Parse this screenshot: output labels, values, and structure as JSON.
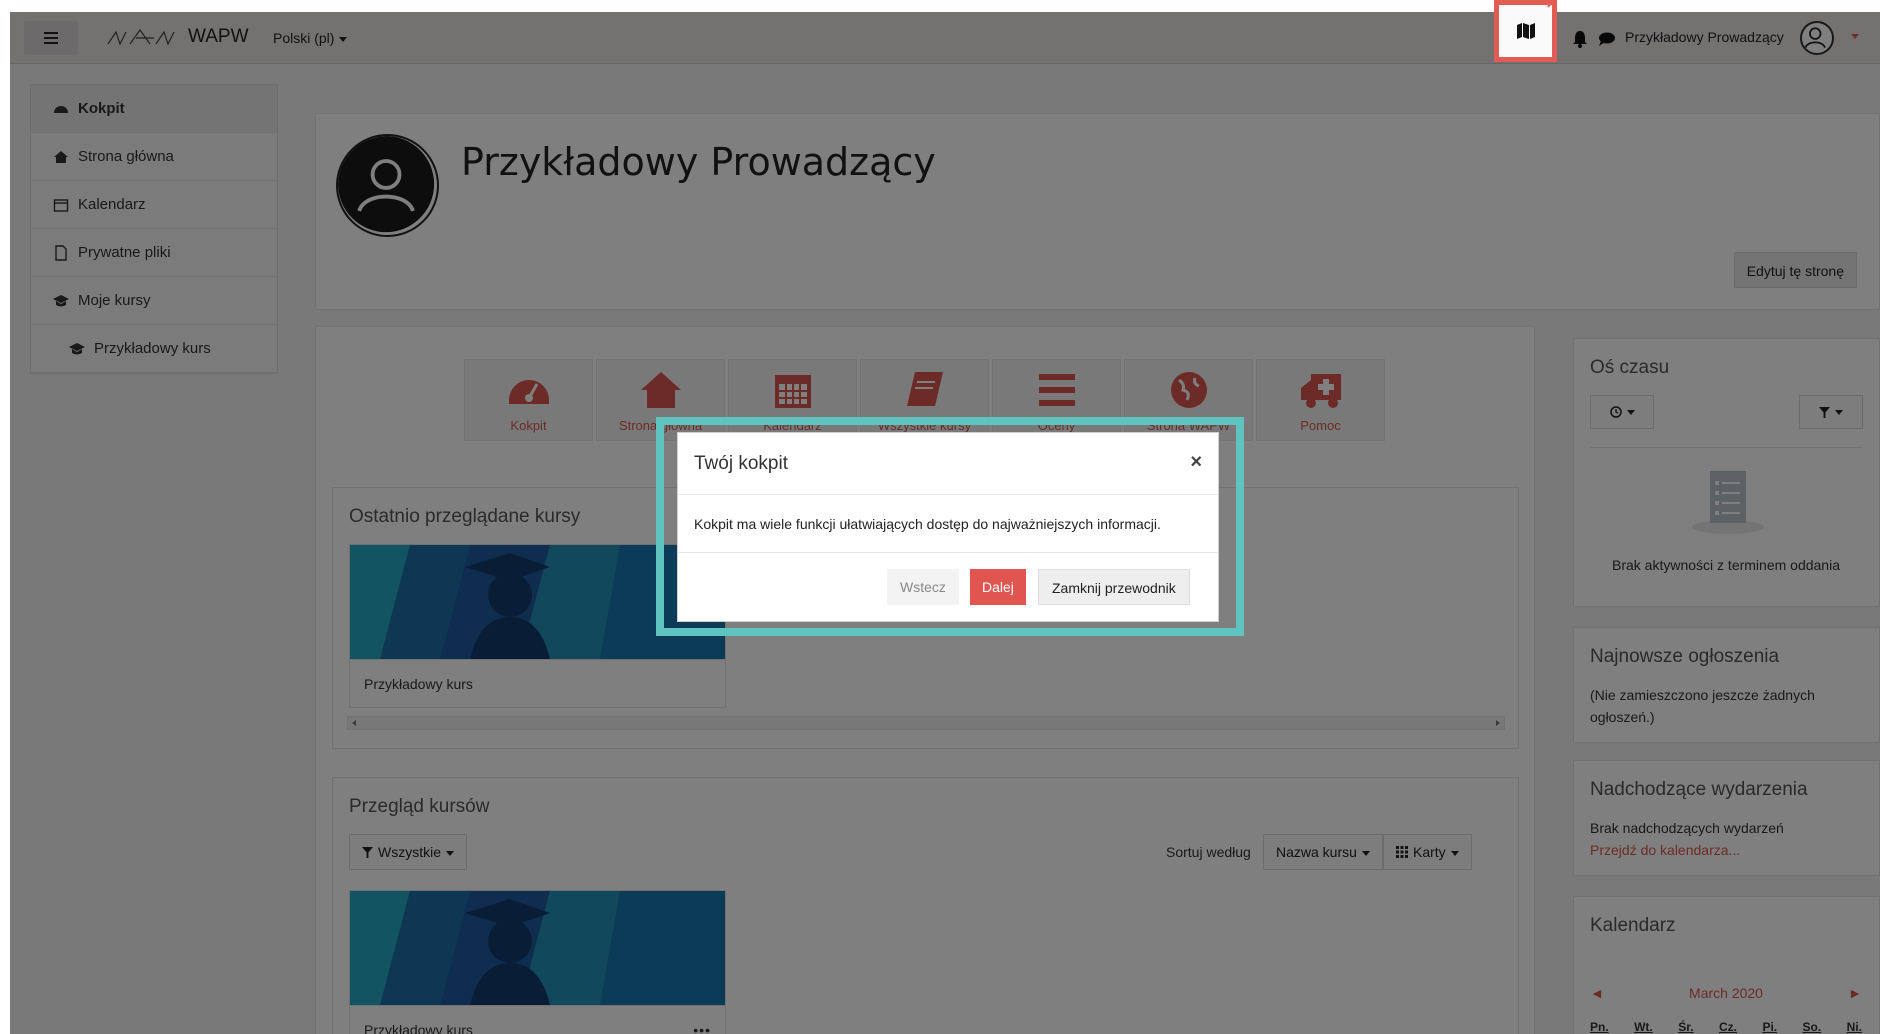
{
  "navbar": {
    "site_name": "WAPW",
    "language": "Polski (pl)",
    "user_name": "Przykładowy Prowadzący"
  },
  "sidebar": {
    "items": [
      {
        "label": "Kokpit"
      },
      {
        "label": "Strona główna"
      },
      {
        "label": "Kalendarz"
      },
      {
        "label": "Prywatne pliki"
      },
      {
        "label": "Moje kursy"
      },
      {
        "label": "Przykładowy kurs"
      }
    ]
  },
  "header": {
    "title": "Przykładowy Prowadzący",
    "edit_button": "Edytuj tę stronę"
  },
  "quicklinks": [
    {
      "label": "Kokpit",
      "icon": "dashboard-icon"
    },
    {
      "label": "Strona główna",
      "icon": "home-icon"
    },
    {
      "label": "Kalendarz",
      "icon": "calendar-icon"
    },
    {
      "label": "Wszystkie kursy",
      "icon": "book-icon"
    },
    {
      "label": "Oceny",
      "icon": "bars-icon"
    },
    {
      "label": "Strona WAPW",
      "icon": "globe-icon"
    },
    {
      "label": "Pomoc",
      "icon": "ambulance-icon"
    }
  ],
  "recent": {
    "title": "Ostatnio przeglądane kursy",
    "course_name": "Przykładowy kurs"
  },
  "overview": {
    "title": "Przegląd kursów",
    "filter_label": "Wszystkie",
    "sort_label": "Sortuj według",
    "sort_value": "Nazwa kursu",
    "view_label": "Karty",
    "course_name": "Przykładowy kurs",
    "more_icon": "•••"
  },
  "timeline": {
    "title": "Oś czasu",
    "empty_text": "Brak aktywności z terminem oddania"
  },
  "news": {
    "title": "Najnowsze ogłoszenia",
    "text": "(Nie zamieszczono jeszcze żadnych ogłoszeń.)"
  },
  "events": {
    "title": "Nadchodzące wydarzenia",
    "text": "Brak nadchodzących wydarzeń",
    "link": "Przejdź do kalendarza..."
  },
  "calendar": {
    "title": "Kalendarz",
    "month": "March 2020",
    "prev": "◄",
    "next": "►",
    "days": [
      "Pn.",
      "Wt.",
      "Śr.",
      "Cz.",
      "Pi.",
      "So.",
      "Ni."
    ],
    "first_day": "1"
  },
  "tour": {
    "title": "Twój kokpit",
    "close": "×",
    "body": "Kokpit ma wiele funkcji ułatwiających dostęp do najważniejszych informacji.",
    "back": "Wstecz",
    "next": "Dalej",
    "end": "Zamknij przewodnik"
  },
  "colors": {
    "accent": "#e0554f",
    "highlight": "#5fc3c0",
    "tour_button_border": "#e05c55"
  }
}
